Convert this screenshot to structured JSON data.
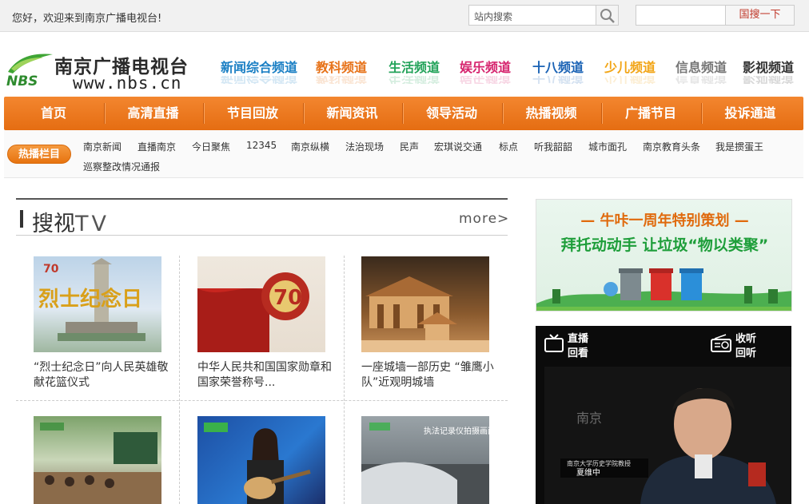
{
  "topbar": {
    "welcome": "您好，欢迎来到南京广播电视台!",
    "search_placeholder": "站内搜索",
    "guosou_button": "国搜一下"
  },
  "logo": {
    "title": "南京广播电视台",
    "url": "www.nbs.cn",
    "abbr": "NBS"
  },
  "channels": [
    {
      "label": "新闻综合频道",
      "color": "#1a7fc4"
    },
    {
      "label": "教科频道",
      "color": "#e7731a"
    },
    {
      "label": "生活频道",
      "color": "#23a35a"
    },
    {
      "label": "娱乐频道",
      "color": "#d6246e"
    },
    {
      "label": "十八频道",
      "color": "#1b63b5"
    },
    {
      "label": "少儿频道",
      "color": "#f2a516"
    },
    {
      "label": "信息频道",
      "color": "#777777"
    },
    {
      "label": "影视频道",
      "color": "#333333"
    }
  ],
  "nav": [
    {
      "label": "首页"
    },
    {
      "label": "高清直播"
    },
    {
      "label": "节目回放"
    },
    {
      "label": "新闻资讯"
    },
    {
      "label": "领导活动"
    },
    {
      "label": "热播视频"
    },
    {
      "label": "广播节目"
    },
    {
      "label": "投诉通道"
    }
  ],
  "hot": {
    "badge": "热播栏目",
    "links": [
      "南京新闻",
      "直播南京",
      "今日聚焦",
      "12345",
      "南京纵横",
      "法治现场",
      "民声",
      "宏琪说交通",
      "标点",
      "听我韶韶",
      "城市面孔",
      "南京教育头条",
      "我是掼蛋王",
      "巡察整改情况通报"
    ]
  },
  "section": {
    "title": "搜视",
    "title_suffix": "TV",
    "more": "more>"
  },
  "videos": [
    {
      "caption": "“烈士纪念日”向人民英雄敬献花篮仪式",
      "thumb_text": "烈士纪念日"
    },
    {
      "caption": "中华人民共和国国家勋章和国家荣誉称号...",
      "thumb_text": "70"
    },
    {
      "caption": "一座城墙一部历史 “雏鹰小队”近观明城墙",
      "thumb_text": ""
    },
    {
      "caption": "",
      "thumb_text": ""
    },
    {
      "caption": "",
      "thumb_text": ""
    },
    {
      "caption": "",
      "thumb_text": "执法记录仪拍摄画面"
    }
  ],
  "banner": {
    "title": "— 牛咔一周年特别策划 —",
    "subtitle": "拜托动动手 让垃圾“物以类聚”"
  },
  "live": {
    "zhibo": "直播",
    "huikan": "回看",
    "shouting": "收听",
    "huiting": "回听",
    "screen_caption": "南京大学历史学院教授",
    "screen_name": "夏维中",
    "watermark": "南京"
  },
  "colors": {
    "nav_orange": "#ec7a1f",
    "accent_red": "#c0392b",
    "green": "#2e8b2e"
  }
}
